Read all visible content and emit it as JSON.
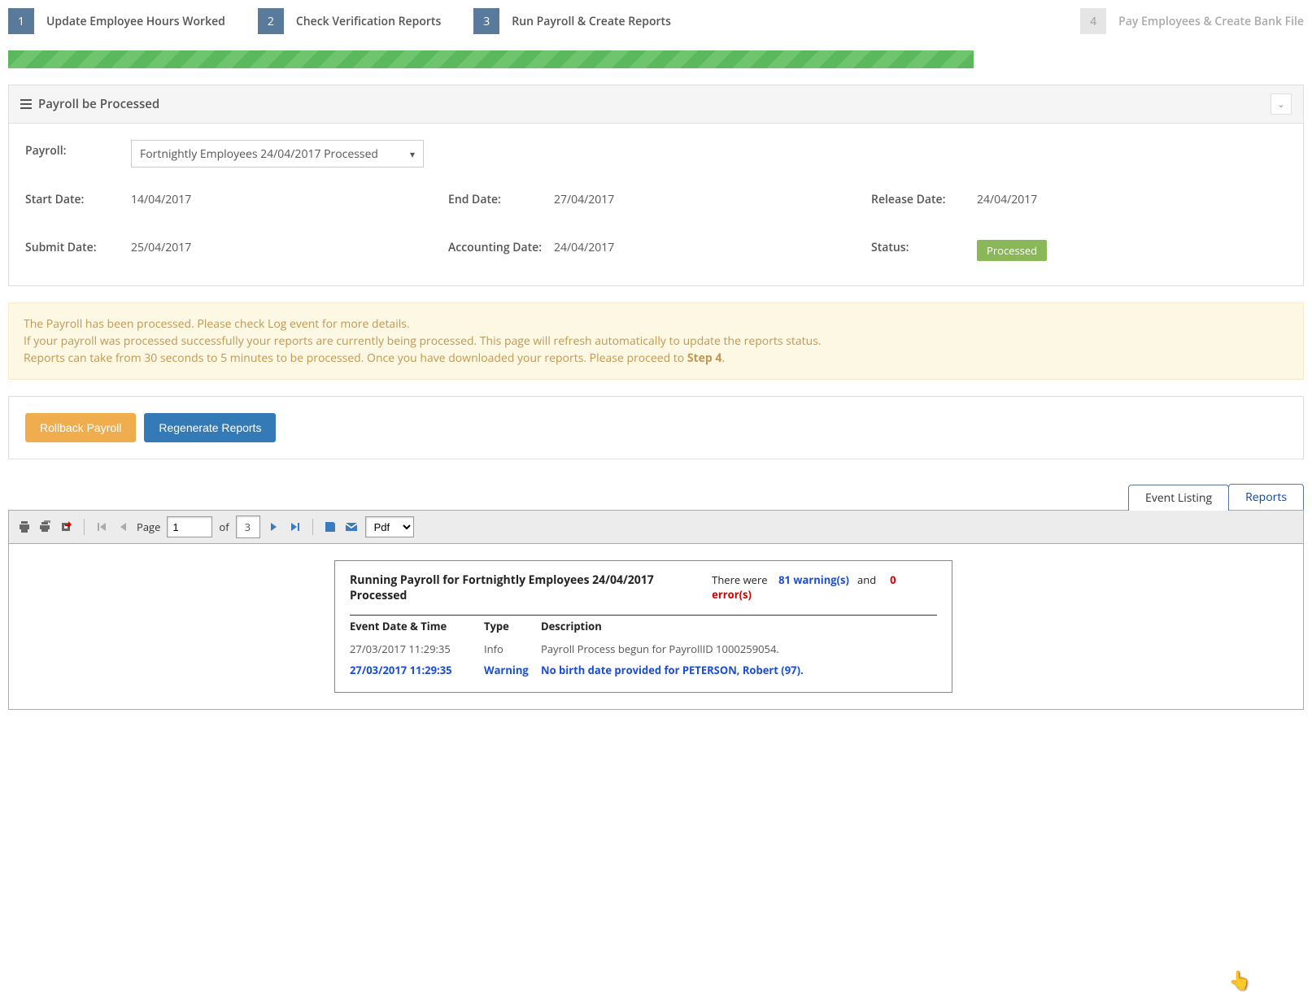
{
  "steps": [
    {
      "num": "1",
      "label": "Update Employee Hours Worked",
      "active": true
    },
    {
      "num": "2",
      "label": "Check Verification Reports",
      "active": true
    },
    {
      "num": "3",
      "label": "Run Payroll & Create Reports",
      "active": true
    },
    {
      "num": "4",
      "label": "Pay Employees & Create Bank File",
      "active": false
    }
  ],
  "panel": {
    "title": "Payroll be Processed",
    "payroll_label": "Payroll:",
    "payroll_select": "Fortnightly Employees 24/04/2017 Processed",
    "start_label": "Start Date:",
    "start_val": "14/04/2017",
    "end_label": "End Date:",
    "end_val": "27/04/2017",
    "release_label": "Release Date:",
    "release_val": "24/04/2017",
    "submit_label": "Submit Date:",
    "submit_val": "25/04/2017",
    "acct_label": "Accounting Date:",
    "acct_val": "24/04/2017",
    "status_label": "Status:",
    "status_val": "Processed"
  },
  "alert": {
    "line1": "The Payroll has been processed. Please check Log event for more details.",
    "line2": "If your payroll was processed successfully your reports are currently being processed. This page will refresh automatically to update the reports status.",
    "line3a": "Reports can take from 30 seconds to 5 minutes to be processed. Once you have downloaded your reports. Please proceed to ",
    "line3b": "Step 4",
    "line3c": "."
  },
  "buttons": {
    "rollback": "Rollback Payroll",
    "regen": "Regenerate Reports"
  },
  "tabs": {
    "event": "Event Listing",
    "reports": "Reports"
  },
  "toolbar": {
    "page_label": "Page",
    "page_val": "1",
    "of_label": "of",
    "page_total": "3",
    "format": "Pdf"
  },
  "report": {
    "title": "Running Payroll for Fortnightly Employees 24/04/2017 Processed",
    "summary_prefix": "There were",
    "warn_count": "81 warning(s)",
    "and": "and",
    "err_count": "0 error(s)",
    "cols": {
      "dt": "Event Date & Time",
      "type": "Type",
      "desc": "Description"
    },
    "rows": [
      {
        "dt": "27/03/2017 11:29:35",
        "type": "Info",
        "desc": "Payroll Process begun for PayrollID 1000259054.",
        "level": "info"
      },
      {
        "dt": "27/03/2017 11:29:35",
        "type": "Warning",
        "desc": "No birth date provided for PETERSON, Robert (97).",
        "level": "warning"
      }
    ]
  }
}
